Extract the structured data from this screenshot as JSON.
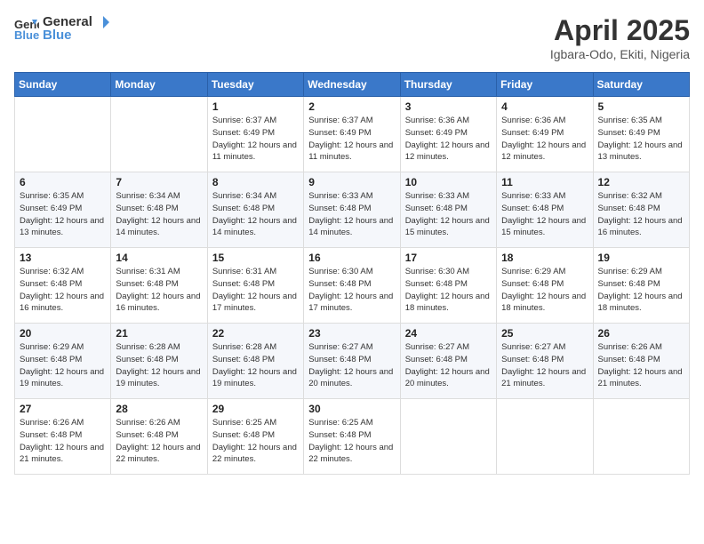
{
  "logo": {
    "general": "General",
    "blue": "Blue"
  },
  "header": {
    "month": "April 2025",
    "location": "Igbara-Odo, Ekiti, Nigeria"
  },
  "weekdays": [
    "Sunday",
    "Monday",
    "Tuesday",
    "Wednesday",
    "Thursday",
    "Friday",
    "Saturday"
  ],
  "weeks": [
    [
      {
        "day": "",
        "info": ""
      },
      {
        "day": "",
        "info": ""
      },
      {
        "day": "1",
        "info": "Sunrise: 6:37 AM\nSunset: 6:49 PM\nDaylight: 12 hours and 11 minutes."
      },
      {
        "day": "2",
        "info": "Sunrise: 6:37 AM\nSunset: 6:49 PM\nDaylight: 12 hours and 11 minutes."
      },
      {
        "day": "3",
        "info": "Sunrise: 6:36 AM\nSunset: 6:49 PM\nDaylight: 12 hours and 12 minutes."
      },
      {
        "day": "4",
        "info": "Sunrise: 6:36 AM\nSunset: 6:49 PM\nDaylight: 12 hours and 12 minutes."
      },
      {
        "day": "5",
        "info": "Sunrise: 6:35 AM\nSunset: 6:49 PM\nDaylight: 12 hours and 13 minutes."
      }
    ],
    [
      {
        "day": "6",
        "info": "Sunrise: 6:35 AM\nSunset: 6:49 PM\nDaylight: 12 hours and 13 minutes."
      },
      {
        "day": "7",
        "info": "Sunrise: 6:34 AM\nSunset: 6:48 PM\nDaylight: 12 hours and 14 minutes."
      },
      {
        "day": "8",
        "info": "Sunrise: 6:34 AM\nSunset: 6:48 PM\nDaylight: 12 hours and 14 minutes."
      },
      {
        "day": "9",
        "info": "Sunrise: 6:33 AM\nSunset: 6:48 PM\nDaylight: 12 hours and 14 minutes."
      },
      {
        "day": "10",
        "info": "Sunrise: 6:33 AM\nSunset: 6:48 PM\nDaylight: 12 hours and 15 minutes."
      },
      {
        "day": "11",
        "info": "Sunrise: 6:33 AM\nSunset: 6:48 PM\nDaylight: 12 hours and 15 minutes."
      },
      {
        "day": "12",
        "info": "Sunrise: 6:32 AM\nSunset: 6:48 PM\nDaylight: 12 hours and 16 minutes."
      }
    ],
    [
      {
        "day": "13",
        "info": "Sunrise: 6:32 AM\nSunset: 6:48 PM\nDaylight: 12 hours and 16 minutes."
      },
      {
        "day": "14",
        "info": "Sunrise: 6:31 AM\nSunset: 6:48 PM\nDaylight: 12 hours and 16 minutes."
      },
      {
        "day": "15",
        "info": "Sunrise: 6:31 AM\nSunset: 6:48 PM\nDaylight: 12 hours and 17 minutes."
      },
      {
        "day": "16",
        "info": "Sunrise: 6:30 AM\nSunset: 6:48 PM\nDaylight: 12 hours and 17 minutes."
      },
      {
        "day": "17",
        "info": "Sunrise: 6:30 AM\nSunset: 6:48 PM\nDaylight: 12 hours and 18 minutes."
      },
      {
        "day": "18",
        "info": "Sunrise: 6:29 AM\nSunset: 6:48 PM\nDaylight: 12 hours and 18 minutes."
      },
      {
        "day": "19",
        "info": "Sunrise: 6:29 AM\nSunset: 6:48 PM\nDaylight: 12 hours and 18 minutes."
      }
    ],
    [
      {
        "day": "20",
        "info": "Sunrise: 6:29 AM\nSunset: 6:48 PM\nDaylight: 12 hours and 19 minutes."
      },
      {
        "day": "21",
        "info": "Sunrise: 6:28 AM\nSunset: 6:48 PM\nDaylight: 12 hours and 19 minutes."
      },
      {
        "day": "22",
        "info": "Sunrise: 6:28 AM\nSunset: 6:48 PM\nDaylight: 12 hours and 19 minutes."
      },
      {
        "day": "23",
        "info": "Sunrise: 6:27 AM\nSunset: 6:48 PM\nDaylight: 12 hours and 20 minutes."
      },
      {
        "day": "24",
        "info": "Sunrise: 6:27 AM\nSunset: 6:48 PM\nDaylight: 12 hours and 20 minutes."
      },
      {
        "day": "25",
        "info": "Sunrise: 6:27 AM\nSunset: 6:48 PM\nDaylight: 12 hours and 21 minutes."
      },
      {
        "day": "26",
        "info": "Sunrise: 6:26 AM\nSunset: 6:48 PM\nDaylight: 12 hours and 21 minutes."
      }
    ],
    [
      {
        "day": "27",
        "info": "Sunrise: 6:26 AM\nSunset: 6:48 PM\nDaylight: 12 hours and 21 minutes."
      },
      {
        "day": "28",
        "info": "Sunrise: 6:26 AM\nSunset: 6:48 PM\nDaylight: 12 hours and 22 minutes."
      },
      {
        "day": "29",
        "info": "Sunrise: 6:25 AM\nSunset: 6:48 PM\nDaylight: 12 hours and 22 minutes."
      },
      {
        "day": "30",
        "info": "Sunrise: 6:25 AM\nSunset: 6:48 PM\nDaylight: 12 hours and 22 minutes."
      },
      {
        "day": "",
        "info": ""
      },
      {
        "day": "",
        "info": ""
      },
      {
        "day": "",
        "info": ""
      }
    ]
  ]
}
